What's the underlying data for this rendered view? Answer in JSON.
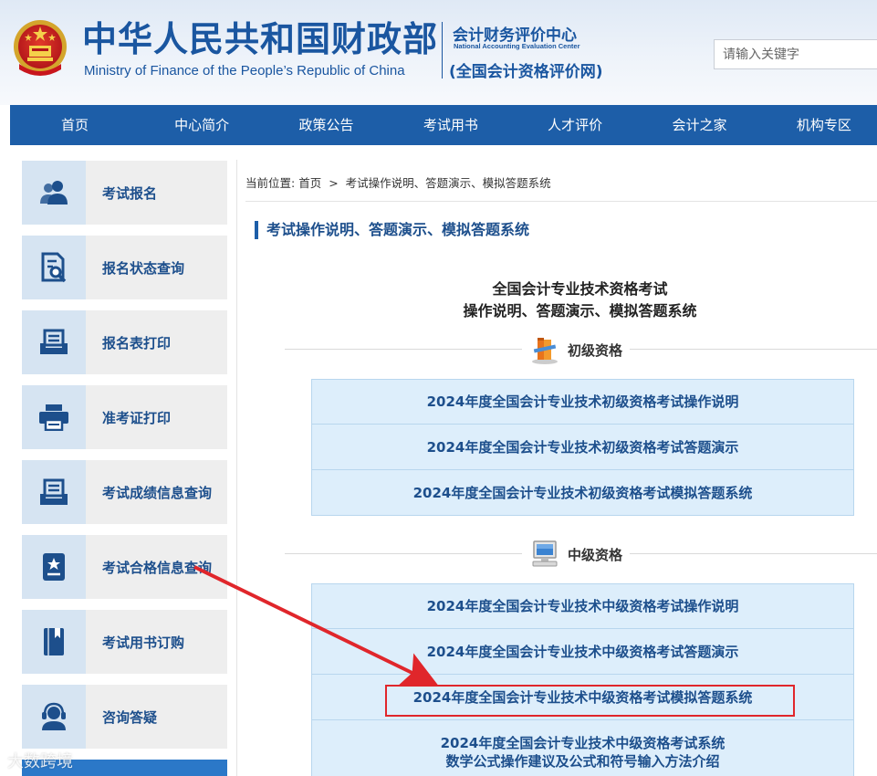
{
  "header": {
    "ministry_cn": "中华人民共和国财政部",
    "ministry_en": "Ministry of Finance of the People’s Republic of China",
    "center_cn": "会计财务评价中心",
    "center_en": "National Accounting Evaluation Center",
    "center_sub": "(全国会计资格评价网)",
    "search_placeholder": "请输入关键字"
  },
  "nav": {
    "items": [
      "首页",
      "中心简介",
      "政策公告",
      "考试用书",
      "人才评价",
      "会计之家",
      "机构专区"
    ]
  },
  "sidebar": {
    "items": [
      {
        "label": "考试报名",
        "icon": "users-icon"
      },
      {
        "label": "报名状态查询",
        "icon": "document-search-icon"
      },
      {
        "label": "报名表打印",
        "icon": "print-form-icon"
      },
      {
        "label": "准考证打印",
        "icon": "printer-icon"
      },
      {
        "label": "考试成绩信息查询",
        "icon": "score-tray-icon"
      },
      {
        "label": "考试合格信息查询",
        "icon": "certificate-icon"
      },
      {
        "label": "考试用书订购",
        "icon": "book-icon"
      },
      {
        "label": "咨询答疑",
        "icon": "support-agent-icon"
      }
    ]
  },
  "breadcrumb": {
    "prefix": "当前位置:",
    "home": "首页",
    "separator": ">",
    "current": "考试操作说明、答题演示、模拟答题系统"
  },
  "section_title": "考试操作说明、答题演示、模拟答题系统",
  "main_title": {
    "line1": "全国会计专业技术资格考试",
    "line2": "操作说明、答题演示、模拟答题系统"
  },
  "categories": [
    {
      "label": "初级资格",
      "icon": "books-icon",
      "links": [
        "2024年度全国会计专业技术初级资格考试操作说明",
        "2024年度全国会计专业技术初级资格考试答题演示",
        "2024年度全国会计专业技术初级资格考试模拟答题系统"
      ]
    },
    {
      "label": "中级资格",
      "icon": "computer-icon",
      "links": [
        "2024年度全国会计专业技术中级资格考试操作说明",
        "2024年度全国会计专业技术中级资格考试答题演示",
        "2024年度全国会计专业技术中级资格考试模拟答题系统",
        "2024年度全国会计专业技术中级资格考试系统"
      ],
      "link4_line2": "数学公式操作建议及公式和符号输入方法介绍"
    }
  ],
  "annotation": {
    "color": "#e0262b"
  },
  "watermark": "大数跨境",
  "colors": {
    "brand_blue": "#1d5ea8",
    "link_blue": "#1d4f8c",
    "link_bg": "#ddeefb",
    "sidebar_icon_bg": "#d6e4f2"
  }
}
